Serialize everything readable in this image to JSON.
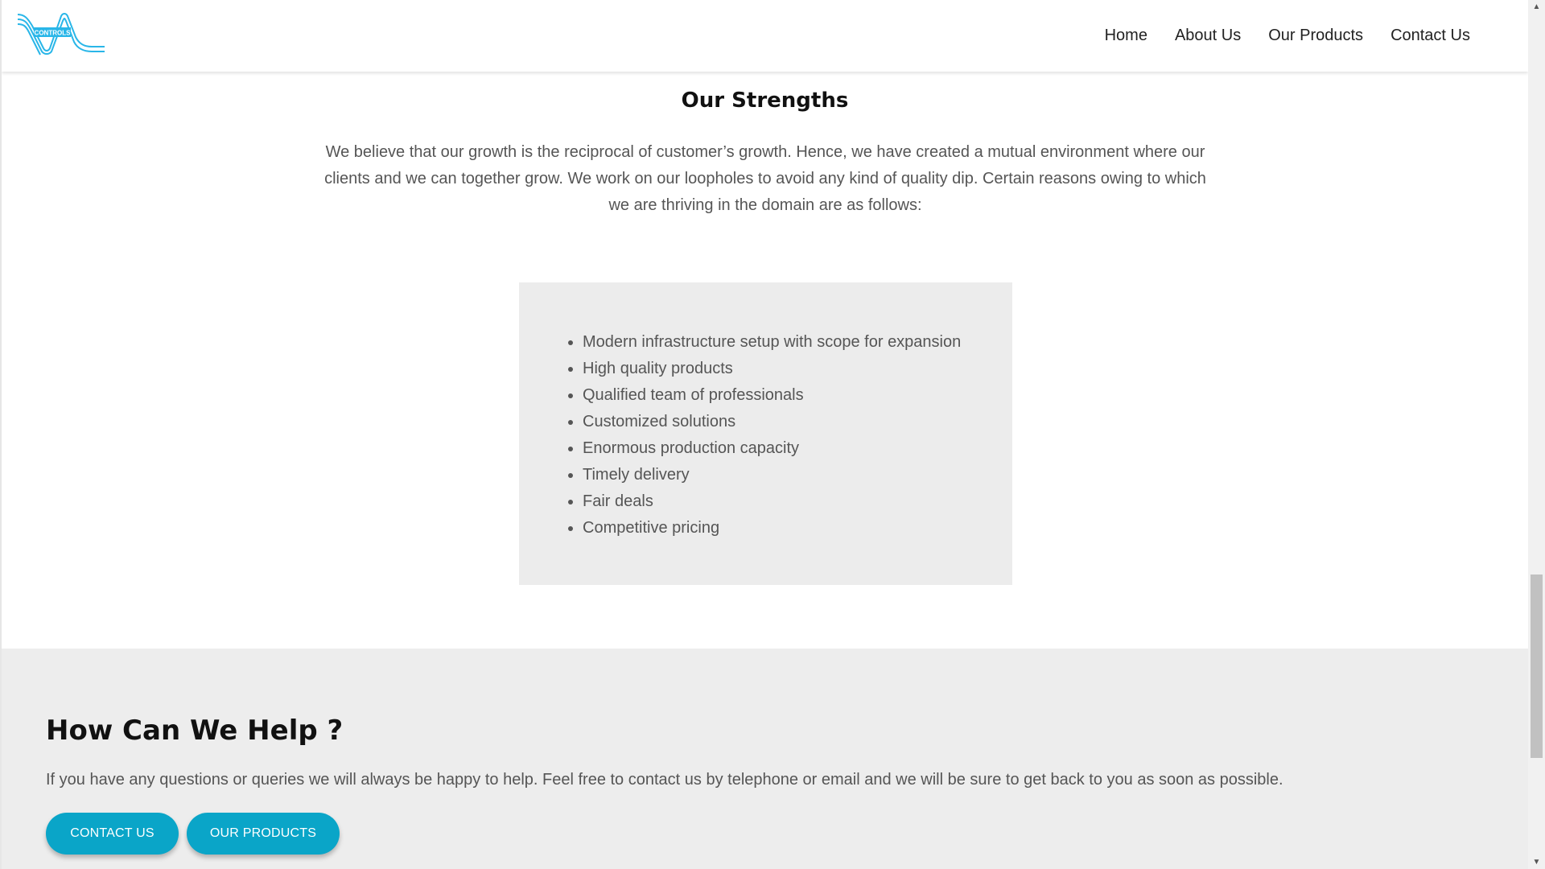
{
  "header": {
    "logo_text": "CONTROLS",
    "nav": [
      {
        "label": "Home"
      },
      {
        "label": "About Us"
      },
      {
        "label": "Our Products"
      },
      {
        "label": "Contact Us"
      }
    ]
  },
  "strengths": {
    "title": "Our Strengths",
    "intro": "We believe that our growth is the reciprocal of customer’s growth. Hence, we have created a mutual environment where our clients and we can together grow. We work on our loopholes to avoid any kind of quality dip. Certain reasons owing to which we are thriving in the domain are as follows:",
    "items": [
      "Modern infrastructure setup with scope for expansion",
      "High quality products",
      "Qualified team of professionals",
      "Customized solutions",
      "Enormous production capacity",
      "Timely delivery",
      "Fair deals",
      "Competitive pricing"
    ]
  },
  "help": {
    "title": "How Can We Help ?",
    "text": "If you have any questions or queries we will always be happy to help. Feel free to contact us by telephone or email and we will be sure to get back to you as soon as possible.",
    "buttons": {
      "contact": "CONTACT US",
      "products": "OUR PRODUCTS"
    }
  },
  "colors": {
    "accent": "#0aa5c8",
    "logo": "#29b6e8",
    "section_bg": "#ededed"
  },
  "icons": {
    "scroll_up": "arrow-up-icon",
    "scroll_down": "arrow-down-icon"
  }
}
